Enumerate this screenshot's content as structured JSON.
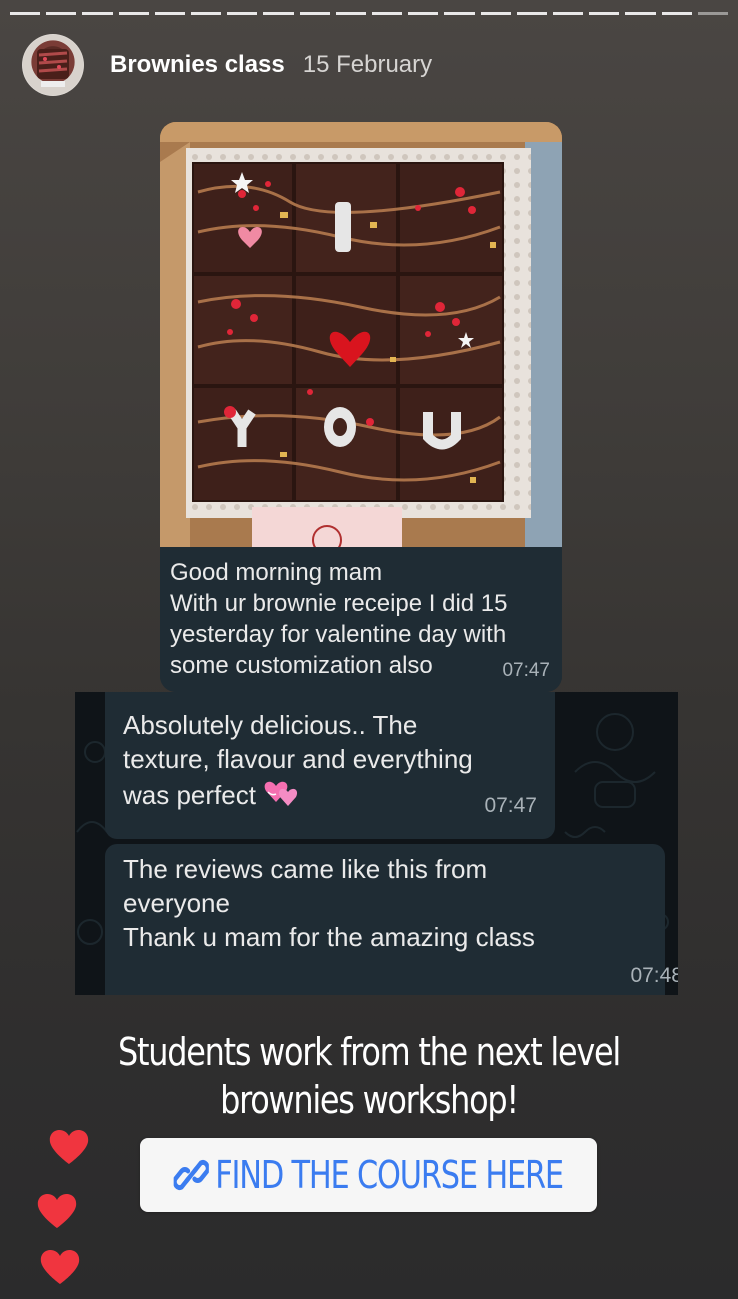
{
  "story": {
    "progress_segments": 20
  },
  "header": {
    "name": "Brownies class",
    "date": "15 February"
  },
  "screenshot1": {
    "caption": "Good morning mam\nWith ur brownie receipe I did 15\nyesterday for valentine day with\nsome customization also",
    "time": "07:47"
  },
  "screenshot2": {
    "message1": "Absolutely delicious.. The\ntexture, flavour and everything\nwas perfect",
    "message1_time": "07:47",
    "message2": "The reviews came like this from\neveryone\nThank u mam for the amazing class",
    "message2_time": "07:48"
  },
  "headline": {
    "line1": "Students work from the next level",
    "line2": "brownies workshop!"
  },
  "link_sticker": {
    "label": "FIND THE COURSE HERE",
    "color": "#3b7cf0"
  },
  "colors": {
    "bubble": "#1f2c34",
    "heart": "#f0353f"
  }
}
